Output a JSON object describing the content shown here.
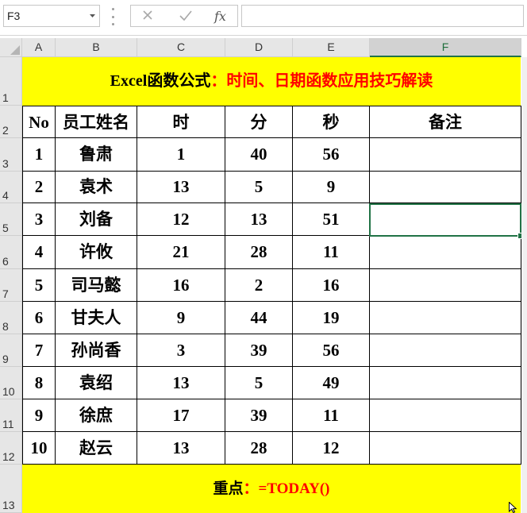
{
  "formula_bar": {
    "name_box": "F3",
    "dropdown_icon": "chevron-down-icon",
    "cancel_icon": "close-icon",
    "enter_icon": "checkmark-icon",
    "function_icon": "fx-icon",
    "formula": ""
  },
  "columns": [
    "A",
    "B",
    "C",
    "D",
    "E",
    "F"
  ],
  "rows": [
    "1",
    "2",
    "3",
    "4",
    "5",
    "6",
    "7",
    "8",
    "9",
    "10",
    "11",
    "12",
    "13"
  ],
  "title": {
    "part1": "Excel函数公式",
    "part2": "：时间、日期函数应用技巧解读"
  },
  "table": {
    "headers": [
      "No",
      "员工姓名",
      "时",
      "分",
      "秒",
      "备注"
    ],
    "rows": [
      [
        "1",
        "鲁肃",
        "1",
        "40",
        "56",
        ""
      ],
      [
        "2",
        "袁术",
        "13",
        "5",
        "9",
        ""
      ],
      [
        "3",
        "刘备",
        "12",
        "13",
        "51",
        ""
      ],
      [
        "4",
        "许攸",
        "21",
        "28",
        "11",
        ""
      ],
      [
        "5",
        "司马懿",
        "16",
        "2",
        "16",
        ""
      ],
      [
        "6",
        "甘夫人",
        "9",
        "44",
        "19",
        ""
      ],
      [
        "7",
        "孙尚香",
        "3",
        "39",
        "56",
        ""
      ],
      [
        "8",
        "袁绍",
        "13",
        "5",
        "49",
        ""
      ],
      [
        "9",
        "徐庶",
        "17",
        "39",
        "11",
        ""
      ],
      [
        "10",
        "赵云",
        "13",
        "28",
        "12",
        ""
      ]
    ]
  },
  "note": {
    "label": "重点",
    "formula": "：=TODAY()"
  },
  "colors": {
    "highlight": "#ffff00",
    "accent_red": "#ff0000",
    "selection": "#217346"
  }
}
